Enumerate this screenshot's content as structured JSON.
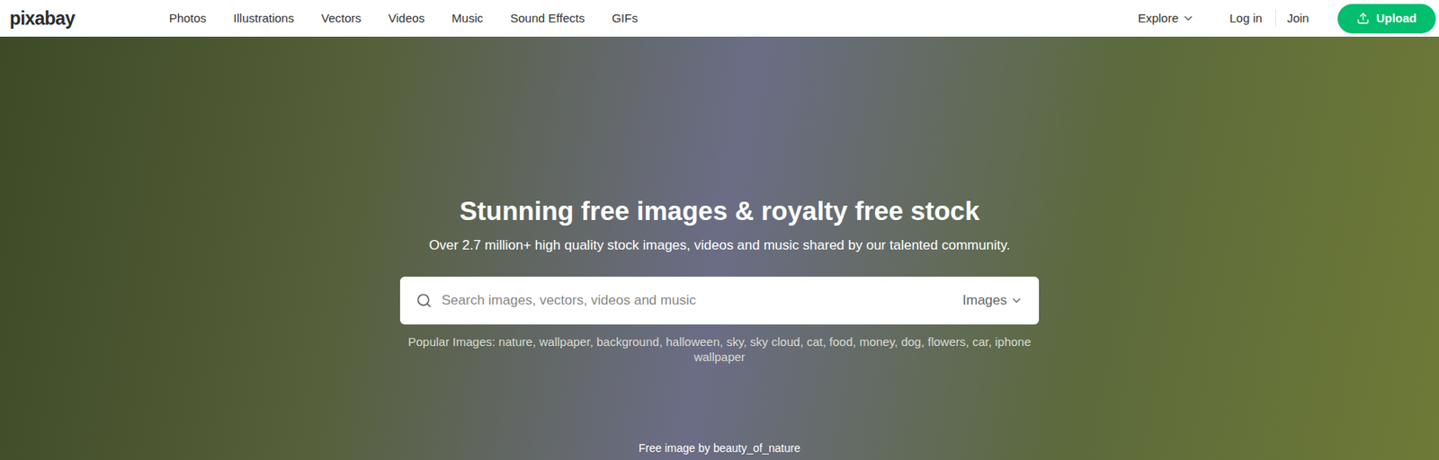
{
  "logo": "pixabay",
  "nav": {
    "items": [
      {
        "label": "Photos"
      },
      {
        "label": "Illustrations"
      },
      {
        "label": "Vectors"
      },
      {
        "label": "Videos"
      },
      {
        "label": "Music"
      },
      {
        "label": "Sound Effects"
      },
      {
        "label": "GIFs"
      }
    ],
    "explore": "Explore",
    "login": "Log in",
    "join": "Join",
    "upload": "Upload"
  },
  "hero": {
    "title": "Stunning free images & royalty free stock",
    "subtitle": "Over 2.7 million+ high quality stock images, videos and music shared by our talented community.",
    "search": {
      "placeholder": "Search images, vectors, videos and music",
      "type": "Images"
    },
    "popular": {
      "label": "Popular Images:",
      "separator": ", ",
      "tags": [
        "nature",
        "wallpaper",
        "background",
        "halloween",
        "sky",
        "sky cloud",
        "cat",
        "food",
        "money",
        "dog",
        "flowers",
        "car",
        "iphone wallpaper"
      ]
    },
    "credit": "Free image by beauty_of_nature"
  }
}
